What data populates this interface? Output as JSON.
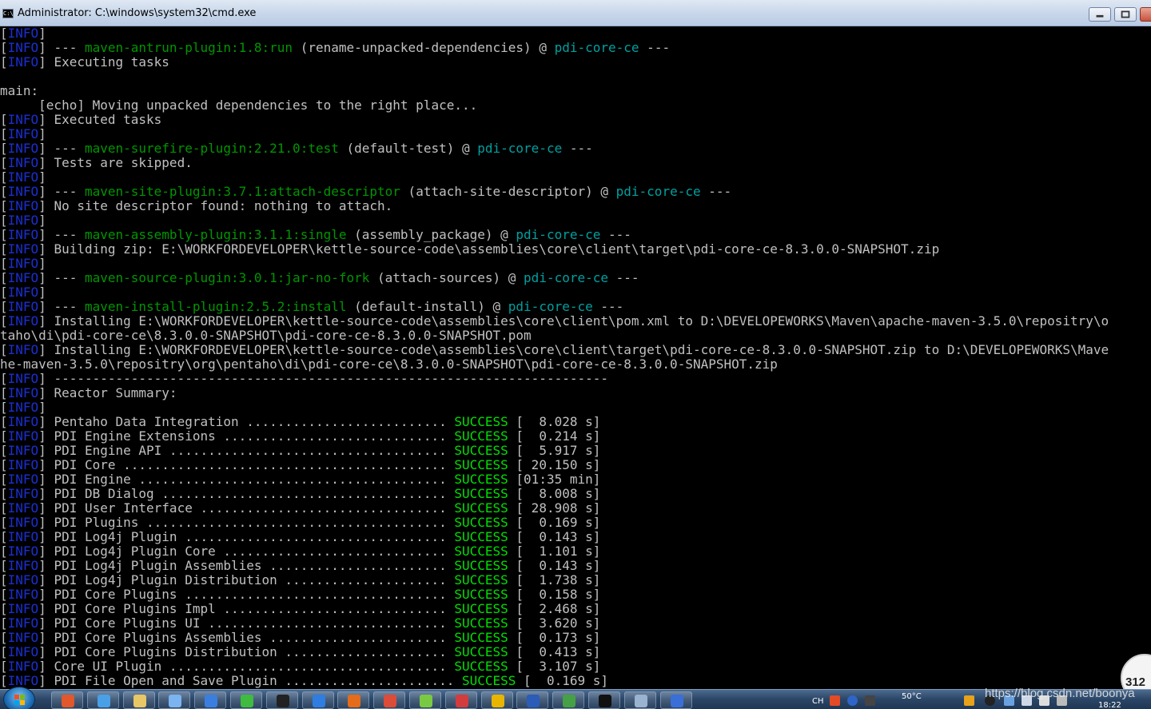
{
  "window": {
    "title": "Administrator: C:\\windows\\system32\\cmd.exe",
    "icon_label": "C:\\"
  },
  "console": {
    "lines": [
      [
        {
          "t": "[",
          "c": "br"
        },
        {
          "t": "INFO",
          "c": "info"
        },
        {
          "t": "]",
          "c": "br"
        }
      ],
      [
        {
          "t": "[",
          "c": "br"
        },
        {
          "t": "INFO",
          "c": "info"
        },
        {
          "t": "] --- ",
          "c": "br"
        },
        {
          "t": "maven-antrun-plugin:1.8:run",
          "c": "plugin"
        },
        {
          "t": " (rename-unpacked-dependencies) @ ",
          "c": "br"
        },
        {
          "t": "pdi-core-ce",
          "c": "art"
        },
        {
          "t": " ---",
          "c": "br"
        }
      ],
      [
        {
          "t": "[",
          "c": "br"
        },
        {
          "t": "INFO",
          "c": "info"
        },
        {
          "t": "] Executing tasks",
          "c": "br"
        }
      ],
      [],
      [
        {
          "t": "main:",
          "c": "br"
        }
      ],
      [
        {
          "t": "     [echo] Moving unpacked dependencies to the right place...",
          "c": "br"
        }
      ],
      [
        {
          "t": "[",
          "c": "br"
        },
        {
          "t": "INFO",
          "c": "info"
        },
        {
          "t": "] Executed tasks",
          "c": "br"
        }
      ],
      [
        {
          "t": "[",
          "c": "br"
        },
        {
          "t": "INFO",
          "c": "info"
        },
        {
          "t": "]",
          "c": "br"
        }
      ],
      [
        {
          "t": "[",
          "c": "br"
        },
        {
          "t": "INFO",
          "c": "info"
        },
        {
          "t": "] --- ",
          "c": "br"
        },
        {
          "t": "maven-surefire-plugin:2.21.0:test",
          "c": "plugin"
        },
        {
          "t": " (default-test) @ ",
          "c": "br"
        },
        {
          "t": "pdi-core-ce",
          "c": "art"
        },
        {
          "t": " ---",
          "c": "br"
        }
      ],
      [
        {
          "t": "[",
          "c": "br"
        },
        {
          "t": "INFO",
          "c": "info"
        },
        {
          "t": "] Tests are skipped.",
          "c": "br"
        }
      ],
      [
        {
          "t": "[",
          "c": "br"
        },
        {
          "t": "INFO",
          "c": "info"
        },
        {
          "t": "]",
          "c": "br"
        }
      ],
      [
        {
          "t": "[",
          "c": "br"
        },
        {
          "t": "INFO",
          "c": "info"
        },
        {
          "t": "] --- ",
          "c": "br"
        },
        {
          "t": "maven-site-plugin:3.7.1:attach-descriptor",
          "c": "plugin"
        },
        {
          "t": " (attach-site-descriptor) @ ",
          "c": "br"
        },
        {
          "t": "pdi-core-ce",
          "c": "art"
        },
        {
          "t": " ---",
          "c": "br"
        }
      ],
      [
        {
          "t": "[",
          "c": "br"
        },
        {
          "t": "INFO",
          "c": "info"
        },
        {
          "t": "] No site descriptor found: nothing to attach.",
          "c": "br"
        }
      ],
      [
        {
          "t": "[",
          "c": "br"
        },
        {
          "t": "INFO",
          "c": "info"
        },
        {
          "t": "]",
          "c": "br"
        }
      ],
      [
        {
          "t": "[",
          "c": "br"
        },
        {
          "t": "INFO",
          "c": "info"
        },
        {
          "t": "] --- ",
          "c": "br"
        },
        {
          "t": "maven-assembly-plugin:3.1.1:single",
          "c": "plugin"
        },
        {
          "t": " (assembly_package) @ ",
          "c": "br"
        },
        {
          "t": "pdi-core-ce",
          "c": "art"
        },
        {
          "t": " ---",
          "c": "br"
        }
      ],
      [
        {
          "t": "[",
          "c": "br"
        },
        {
          "t": "INFO",
          "c": "info"
        },
        {
          "t": "] Building zip: E:\\WORKFORDEVELOPER\\kettle-source-code\\assemblies\\core\\client\\target\\pdi-core-ce-8.3.0.0-SNAPSHOT.zip",
          "c": "br"
        }
      ],
      [
        {
          "t": "[",
          "c": "br"
        },
        {
          "t": "INFO",
          "c": "info"
        },
        {
          "t": "]",
          "c": "br"
        }
      ],
      [
        {
          "t": "[",
          "c": "br"
        },
        {
          "t": "INFO",
          "c": "info"
        },
        {
          "t": "] --- ",
          "c": "br"
        },
        {
          "t": "maven-source-plugin:3.0.1:jar-no-fork",
          "c": "plugin"
        },
        {
          "t": " (attach-sources) @ ",
          "c": "br"
        },
        {
          "t": "pdi-core-ce",
          "c": "art"
        },
        {
          "t": " ---",
          "c": "br"
        }
      ],
      [
        {
          "t": "[",
          "c": "br"
        },
        {
          "t": "INFO",
          "c": "info"
        },
        {
          "t": "]",
          "c": "br"
        }
      ],
      [
        {
          "t": "[",
          "c": "br"
        },
        {
          "t": "INFO",
          "c": "info"
        },
        {
          "t": "] --- ",
          "c": "br"
        },
        {
          "t": "maven-install-plugin:2.5.2:install",
          "c": "plugin"
        },
        {
          "t": " (default-install) @ ",
          "c": "br"
        },
        {
          "t": "pdi-core-ce",
          "c": "art"
        },
        {
          "t": " ---",
          "c": "br"
        }
      ],
      [
        {
          "t": "[",
          "c": "br"
        },
        {
          "t": "INFO",
          "c": "info"
        },
        {
          "t": "] Installing E:\\WORKFORDEVELOPER\\kettle-source-code\\assemblies\\core\\client\\pom.xml to D:\\DEVELOPEWORKS\\Maven\\apache-maven-3.5.0\\repositry\\o",
          "c": "br"
        }
      ],
      [
        {
          "t": "taho\\di\\pdi-core-ce\\8.3.0.0-SNAPSHOT\\pdi-core-ce-8.3.0.0-SNAPSHOT.pom",
          "c": "br"
        }
      ],
      [
        {
          "t": "[",
          "c": "br"
        },
        {
          "t": "INFO",
          "c": "info"
        },
        {
          "t": "] Installing E:\\WORKFORDEVELOPER\\kettle-source-code\\assemblies\\core\\client\\target\\pdi-core-ce-8.3.0.0-SNAPSHOT.zip to D:\\DEVELOPEWORKS\\Mave",
          "c": "br"
        }
      ],
      [
        {
          "t": "he-maven-3.5.0\\repositry\\org\\pentaho\\di\\pdi-core-ce\\8.3.0.0-SNAPSHOT\\pdi-core-ce-8.3.0.0-SNAPSHOT.zip",
          "c": "br"
        }
      ],
      [
        {
          "t": "[",
          "c": "br"
        },
        {
          "t": "INFO",
          "c": "info"
        },
        {
          "t": "] ------------------------------------------------------------------------",
          "c": "br"
        }
      ],
      [
        {
          "t": "[",
          "c": "br"
        },
        {
          "t": "INFO",
          "c": "info"
        },
        {
          "t": "] Reactor Summary:",
          "c": "br"
        }
      ],
      [
        {
          "t": "[",
          "c": "br"
        },
        {
          "t": "INFO",
          "c": "info"
        },
        {
          "t": "]",
          "c": "br"
        }
      ],
      [
        {
          "t": "[",
          "c": "br"
        },
        {
          "t": "INFO",
          "c": "info"
        },
        {
          "t": "] Pentaho Data Integration .......................... ",
          "c": "br"
        },
        {
          "t": "SUCCESS",
          "c": "succ"
        },
        {
          "t": " [  8.028 s]",
          "c": "br"
        }
      ],
      [
        {
          "t": "[",
          "c": "br"
        },
        {
          "t": "INFO",
          "c": "info"
        },
        {
          "t": "] PDI Engine Extensions ............................. ",
          "c": "br"
        },
        {
          "t": "SUCCESS",
          "c": "succ"
        },
        {
          "t": " [  0.214 s]",
          "c": "br"
        }
      ],
      [
        {
          "t": "[",
          "c": "br"
        },
        {
          "t": "INFO",
          "c": "info"
        },
        {
          "t": "] PDI Engine API .................................... ",
          "c": "br"
        },
        {
          "t": "SUCCESS",
          "c": "succ"
        },
        {
          "t": " [  5.917 s]",
          "c": "br"
        }
      ],
      [
        {
          "t": "[",
          "c": "br"
        },
        {
          "t": "INFO",
          "c": "info"
        },
        {
          "t": "] PDI Core .......................................... ",
          "c": "br"
        },
        {
          "t": "SUCCESS",
          "c": "succ"
        },
        {
          "t": " [ 20.150 s]",
          "c": "br"
        }
      ],
      [
        {
          "t": "[",
          "c": "br"
        },
        {
          "t": "INFO",
          "c": "info"
        },
        {
          "t": "] PDI Engine ........................................ ",
          "c": "br"
        },
        {
          "t": "SUCCESS",
          "c": "succ"
        },
        {
          "t": " [01:35 min]",
          "c": "br"
        }
      ],
      [
        {
          "t": "[",
          "c": "br"
        },
        {
          "t": "INFO",
          "c": "info"
        },
        {
          "t": "] PDI DB Dialog ..................................... ",
          "c": "br"
        },
        {
          "t": "SUCCESS",
          "c": "succ"
        },
        {
          "t": " [  8.008 s]",
          "c": "br"
        }
      ],
      [
        {
          "t": "[",
          "c": "br"
        },
        {
          "t": "INFO",
          "c": "info"
        },
        {
          "t": "] PDI User Interface ................................ ",
          "c": "br"
        },
        {
          "t": "SUCCESS",
          "c": "succ"
        },
        {
          "t": " [ 28.908 s]",
          "c": "br"
        }
      ],
      [
        {
          "t": "[",
          "c": "br"
        },
        {
          "t": "INFO",
          "c": "info"
        },
        {
          "t": "] PDI Plugins ....................................... ",
          "c": "br"
        },
        {
          "t": "SUCCESS",
          "c": "succ"
        },
        {
          "t": " [  0.169 s]",
          "c": "br"
        }
      ],
      [
        {
          "t": "[",
          "c": "br"
        },
        {
          "t": "INFO",
          "c": "info"
        },
        {
          "t": "] PDI Log4j Plugin .................................. ",
          "c": "br"
        },
        {
          "t": "SUCCESS",
          "c": "succ"
        },
        {
          "t": " [  0.143 s]",
          "c": "br"
        }
      ],
      [
        {
          "t": "[",
          "c": "br"
        },
        {
          "t": "INFO",
          "c": "info"
        },
        {
          "t": "] PDI Log4j Plugin Core ............................. ",
          "c": "br"
        },
        {
          "t": "SUCCESS",
          "c": "succ"
        },
        {
          "t": " [  1.101 s]",
          "c": "br"
        }
      ],
      [
        {
          "t": "[",
          "c": "br"
        },
        {
          "t": "INFO",
          "c": "info"
        },
        {
          "t": "] PDI Log4j Plugin Assemblies ....................... ",
          "c": "br"
        },
        {
          "t": "SUCCESS",
          "c": "succ"
        },
        {
          "t": " [  0.143 s]",
          "c": "br"
        }
      ],
      [
        {
          "t": "[",
          "c": "br"
        },
        {
          "t": "INFO",
          "c": "info"
        },
        {
          "t": "] PDI Log4j Plugin Distribution ..................... ",
          "c": "br"
        },
        {
          "t": "SUCCESS",
          "c": "succ"
        },
        {
          "t": " [  1.738 s]",
          "c": "br"
        }
      ],
      [
        {
          "t": "[",
          "c": "br"
        },
        {
          "t": "INFO",
          "c": "info"
        },
        {
          "t": "] PDI Core Plugins .................................. ",
          "c": "br"
        },
        {
          "t": "SUCCESS",
          "c": "succ"
        },
        {
          "t": " [  0.158 s]",
          "c": "br"
        }
      ],
      [
        {
          "t": "[",
          "c": "br"
        },
        {
          "t": "INFO",
          "c": "info"
        },
        {
          "t": "] PDI Core Plugins Impl ............................. ",
          "c": "br"
        },
        {
          "t": "SUCCESS",
          "c": "succ"
        },
        {
          "t": " [  2.468 s]",
          "c": "br"
        }
      ],
      [
        {
          "t": "[",
          "c": "br"
        },
        {
          "t": "INFO",
          "c": "info"
        },
        {
          "t": "] PDI Core Plugins UI ............................... ",
          "c": "br"
        },
        {
          "t": "SUCCESS",
          "c": "succ"
        },
        {
          "t": " [  3.620 s]",
          "c": "br"
        }
      ],
      [
        {
          "t": "[",
          "c": "br"
        },
        {
          "t": "INFO",
          "c": "info"
        },
        {
          "t": "] PDI Core Plugins Assemblies ....................... ",
          "c": "br"
        },
        {
          "t": "SUCCESS",
          "c": "succ"
        },
        {
          "t": " [  0.173 s]",
          "c": "br"
        }
      ],
      [
        {
          "t": "[",
          "c": "br"
        },
        {
          "t": "INFO",
          "c": "info"
        },
        {
          "t": "] PDI Core Plugins Distribution ..................... ",
          "c": "br"
        },
        {
          "t": "SUCCESS",
          "c": "succ"
        },
        {
          "t": " [  0.413 s]",
          "c": "br"
        }
      ],
      [
        {
          "t": "[",
          "c": "br"
        },
        {
          "t": "INFO",
          "c": "info"
        },
        {
          "t": "] Core UI Plugin .................................... ",
          "c": "br"
        },
        {
          "t": "SUCCESS",
          "c": "succ"
        },
        {
          "t": " [  3.107 s]",
          "c": "br"
        }
      ],
      [
        {
          "t": "[",
          "c": "br"
        },
        {
          "t": "INFO",
          "c": "info"
        },
        {
          "t": "] PDI File Open and Save Plugin ...................... ",
          "c": "br"
        },
        {
          "t": "SUCCESS",
          "c": "succ"
        },
        {
          "t": " [  0.169 s]",
          "c": "br"
        }
      ]
    ]
  },
  "colors": {
    "info": "#1b2fd1",
    "plugin": "#009600",
    "artifact": "#00a0a0",
    "success": "#00e000",
    "text": "#c0c0c0",
    "background": "#000000"
  },
  "float_widget": {
    "text": "312"
  },
  "taskbar": {
    "items": [
      {
        "name": "ppt-taskbar-item",
        "icon": "slides-icon",
        "color": "#e2572b"
      },
      {
        "name": "explorer-taskbar-item-1",
        "icon": "folder-icon",
        "color": "#4aa0e6"
      },
      {
        "name": "explorer-taskbar-item-2",
        "icon": "folder-icon",
        "color": "#e7c766"
      },
      {
        "name": "network-taskbar-item",
        "icon": "network-icon",
        "color": "#7bb4f0"
      },
      {
        "name": "feather-taskbar-item",
        "icon": "feather-icon",
        "color": "#3a7fe0"
      },
      {
        "name": "wechat-taskbar-item",
        "icon": "chat-icon",
        "color": "#3fbb3f"
      },
      {
        "name": "qq-taskbar-item",
        "icon": "penguin-icon",
        "color": "#222222"
      },
      {
        "name": "ie-taskbar-item",
        "icon": "ie-icon",
        "color": "#2f7de1"
      },
      {
        "name": "firefox-taskbar-item",
        "icon": "firefox-icon",
        "color": "#e46c1a"
      },
      {
        "name": "chrome-taskbar-item",
        "icon": "chrome-icon",
        "color": "#dd4b39"
      },
      {
        "name": "app-taskbar-item-1",
        "icon": "app-icon",
        "color": "#7ac943"
      },
      {
        "name": "app-taskbar-item-2",
        "icon": "app-icon",
        "color": "#d23c3c"
      },
      {
        "name": "app-taskbar-item-3",
        "icon": "app-icon",
        "color": "#e8b500"
      },
      {
        "name": "word-taskbar-item",
        "icon": "word-icon",
        "color": "#2b5cb8"
      },
      {
        "name": "app-taskbar-item-4",
        "icon": "app-icon",
        "color": "#46a046"
      },
      {
        "name": "cmd-taskbar-item",
        "icon": "terminal-icon",
        "color": "#111111"
      },
      {
        "name": "app-taskbar-item-5",
        "icon": "app-icon",
        "color": "#9ab3cf"
      },
      {
        "name": "app-taskbar-item-6",
        "icon": "app-icon",
        "color": "#3a6fd8"
      }
    ],
    "tray": {
      "lang": "CH",
      "temp": "50°C",
      "time": "18:22"
    }
  },
  "watermark": "https://blog.csdn.net/boonya"
}
